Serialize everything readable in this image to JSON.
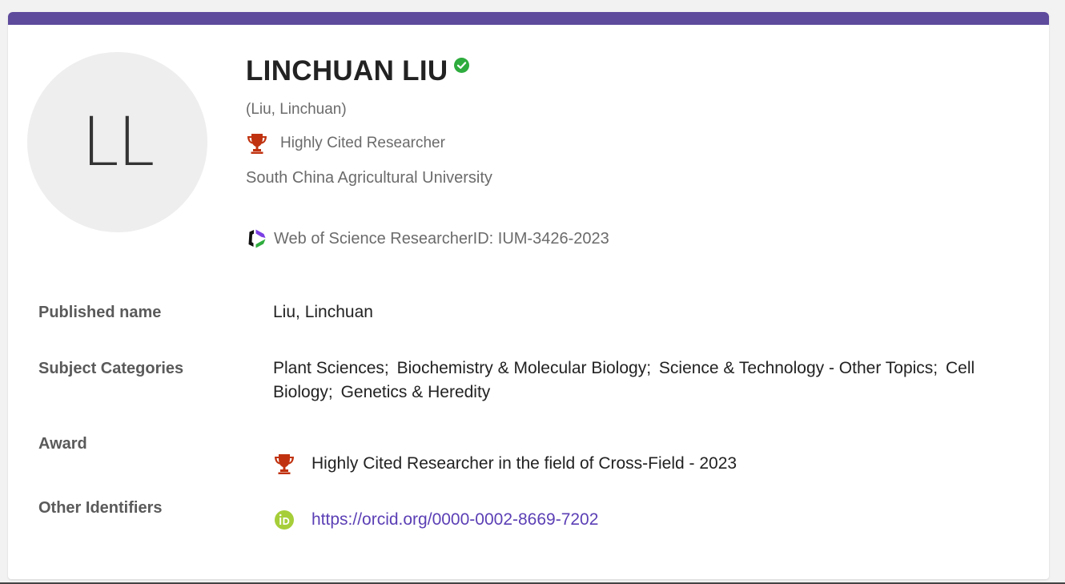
{
  "profile": {
    "initials": "LL",
    "name": "LINCHUAN LIU",
    "alt_name": "(Liu, Linchuan)",
    "highly_cited_label": "Highly Cited Researcher",
    "affiliation": "South China Agricultural University",
    "researcher_id": "Web of Science ResearcherID: IUM-3426-2023",
    "icons": {
      "verified": "verified-check-icon",
      "trophy": "trophy-icon",
      "wos": "web-of-science-icon",
      "orcid": "orcid-icon"
    }
  },
  "details": {
    "published_name": {
      "label": "Published name",
      "value": "Liu, Linchuan"
    },
    "subject_categories": {
      "label": "Subject Categories",
      "items": [
        "Plant Sciences;",
        "Biochemistry & Molecular Biology;",
        "Science & Technology - Other Topics;",
        "Cell Biology;",
        "Genetics & Heredity"
      ]
    },
    "award": {
      "label": "Award",
      "value": "Highly Cited Researcher in the field of Cross-Field - 2023"
    },
    "other_identifiers": {
      "label": "Other Identifiers",
      "value": "https://orcid.org/0000-0002-8669-7202"
    }
  },
  "colors": {
    "accent": "#5e4b9c",
    "trophy": "#c0320f",
    "verified": "#2eac3d",
    "orcid": "#a6ce39",
    "link": "#5b3fb5"
  }
}
